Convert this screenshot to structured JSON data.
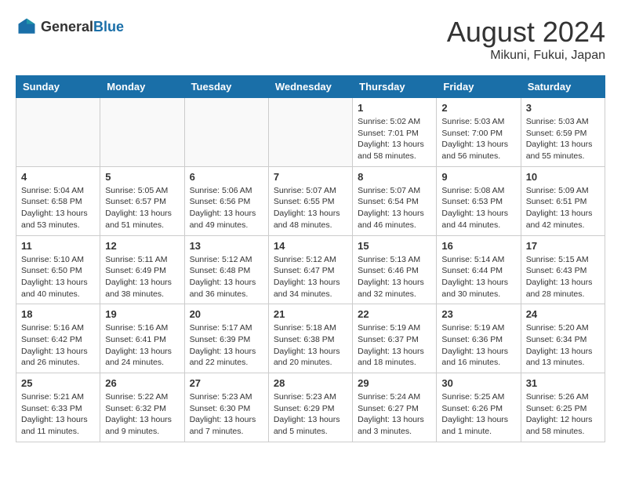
{
  "header": {
    "logo": {
      "general": "General",
      "blue": "Blue"
    },
    "title": "August 2024",
    "location": "Mikuni, Fukui, Japan"
  },
  "weekdays": [
    "Sunday",
    "Monday",
    "Tuesday",
    "Wednesday",
    "Thursday",
    "Friday",
    "Saturday"
  ],
  "weeks": [
    [
      {
        "day": "",
        "info": ""
      },
      {
        "day": "",
        "info": ""
      },
      {
        "day": "",
        "info": ""
      },
      {
        "day": "",
        "info": ""
      },
      {
        "day": "1",
        "info": "Sunrise: 5:02 AM\nSunset: 7:01 PM\nDaylight: 13 hours\nand 58 minutes."
      },
      {
        "day": "2",
        "info": "Sunrise: 5:03 AM\nSunset: 7:00 PM\nDaylight: 13 hours\nand 56 minutes."
      },
      {
        "day": "3",
        "info": "Sunrise: 5:03 AM\nSunset: 6:59 PM\nDaylight: 13 hours\nand 55 minutes."
      }
    ],
    [
      {
        "day": "4",
        "info": "Sunrise: 5:04 AM\nSunset: 6:58 PM\nDaylight: 13 hours\nand 53 minutes."
      },
      {
        "day": "5",
        "info": "Sunrise: 5:05 AM\nSunset: 6:57 PM\nDaylight: 13 hours\nand 51 minutes."
      },
      {
        "day": "6",
        "info": "Sunrise: 5:06 AM\nSunset: 6:56 PM\nDaylight: 13 hours\nand 49 minutes."
      },
      {
        "day": "7",
        "info": "Sunrise: 5:07 AM\nSunset: 6:55 PM\nDaylight: 13 hours\nand 48 minutes."
      },
      {
        "day": "8",
        "info": "Sunrise: 5:07 AM\nSunset: 6:54 PM\nDaylight: 13 hours\nand 46 minutes."
      },
      {
        "day": "9",
        "info": "Sunrise: 5:08 AM\nSunset: 6:53 PM\nDaylight: 13 hours\nand 44 minutes."
      },
      {
        "day": "10",
        "info": "Sunrise: 5:09 AM\nSunset: 6:51 PM\nDaylight: 13 hours\nand 42 minutes."
      }
    ],
    [
      {
        "day": "11",
        "info": "Sunrise: 5:10 AM\nSunset: 6:50 PM\nDaylight: 13 hours\nand 40 minutes."
      },
      {
        "day": "12",
        "info": "Sunrise: 5:11 AM\nSunset: 6:49 PM\nDaylight: 13 hours\nand 38 minutes."
      },
      {
        "day": "13",
        "info": "Sunrise: 5:12 AM\nSunset: 6:48 PM\nDaylight: 13 hours\nand 36 minutes."
      },
      {
        "day": "14",
        "info": "Sunrise: 5:12 AM\nSunset: 6:47 PM\nDaylight: 13 hours\nand 34 minutes."
      },
      {
        "day": "15",
        "info": "Sunrise: 5:13 AM\nSunset: 6:46 PM\nDaylight: 13 hours\nand 32 minutes."
      },
      {
        "day": "16",
        "info": "Sunrise: 5:14 AM\nSunset: 6:44 PM\nDaylight: 13 hours\nand 30 minutes."
      },
      {
        "day": "17",
        "info": "Sunrise: 5:15 AM\nSunset: 6:43 PM\nDaylight: 13 hours\nand 28 minutes."
      }
    ],
    [
      {
        "day": "18",
        "info": "Sunrise: 5:16 AM\nSunset: 6:42 PM\nDaylight: 13 hours\nand 26 minutes."
      },
      {
        "day": "19",
        "info": "Sunrise: 5:16 AM\nSunset: 6:41 PM\nDaylight: 13 hours\nand 24 minutes."
      },
      {
        "day": "20",
        "info": "Sunrise: 5:17 AM\nSunset: 6:39 PM\nDaylight: 13 hours\nand 22 minutes."
      },
      {
        "day": "21",
        "info": "Sunrise: 5:18 AM\nSunset: 6:38 PM\nDaylight: 13 hours\nand 20 minutes."
      },
      {
        "day": "22",
        "info": "Sunrise: 5:19 AM\nSunset: 6:37 PM\nDaylight: 13 hours\nand 18 minutes."
      },
      {
        "day": "23",
        "info": "Sunrise: 5:19 AM\nSunset: 6:36 PM\nDaylight: 13 hours\nand 16 minutes."
      },
      {
        "day": "24",
        "info": "Sunrise: 5:20 AM\nSunset: 6:34 PM\nDaylight: 13 hours\nand 13 minutes."
      }
    ],
    [
      {
        "day": "25",
        "info": "Sunrise: 5:21 AM\nSunset: 6:33 PM\nDaylight: 13 hours\nand 11 minutes."
      },
      {
        "day": "26",
        "info": "Sunrise: 5:22 AM\nSunset: 6:32 PM\nDaylight: 13 hours\nand 9 minutes."
      },
      {
        "day": "27",
        "info": "Sunrise: 5:23 AM\nSunset: 6:30 PM\nDaylight: 13 hours\nand 7 minutes."
      },
      {
        "day": "28",
        "info": "Sunrise: 5:23 AM\nSunset: 6:29 PM\nDaylight: 13 hours\nand 5 minutes."
      },
      {
        "day": "29",
        "info": "Sunrise: 5:24 AM\nSunset: 6:27 PM\nDaylight: 13 hours\nand 3 minutes."
      },
      {
        "day": "30",
        "info": "Sunrise: 5:25 AM\nSunset: 6:26 PM\nDaylight: 13 hours\nand 1 minute."
      },
      {
        "day": "31",
        "info": "Sunrise: 5:26 AM\nSunset: 6:25 PM\nDaylight: 12 hours\nand 58 minutes."
      }
    ]
  ]
}
